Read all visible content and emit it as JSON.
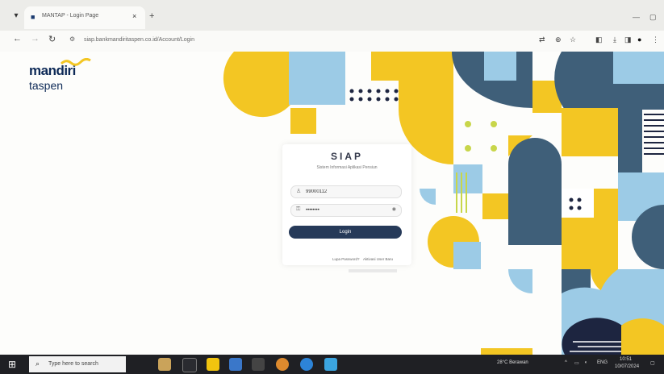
{
  "browser": {
    "tab_title": "MANTAP - Login Page",
    "url": "siap.bankmandiritaspen.co.id/Account/Login",
    "tab_close": "×",
    "new_tab": "+"
  },
  "brand": {
    "name": "mandiri",
    "sub": "taspen",
    "colors": {
      "navy": "#0e2a57",
      "yellow": "#f3c623",
      "light_blue": "#9ccbe6",
      "slate": "#3f5f79"
    }
  },
  "login": {
    "title": "SIAP",
    "subtitle": "Sistem Informasi Aplikasi Pensiun",
    "username_value": "99000112",
    "password_value": "••••••••",
    "button_label": "Login",
    "forgot_label": "Lupa Password?",
    "activate_label": "Aktivasi User Baru"
  },
  "taskbar": {
    "search_placeholder": "Type here to search",
    "weather": "28°C  Berawan",
    "language": "ENG",
    "time": "10:51",
    "date": "10/07/2024"
  }
}
